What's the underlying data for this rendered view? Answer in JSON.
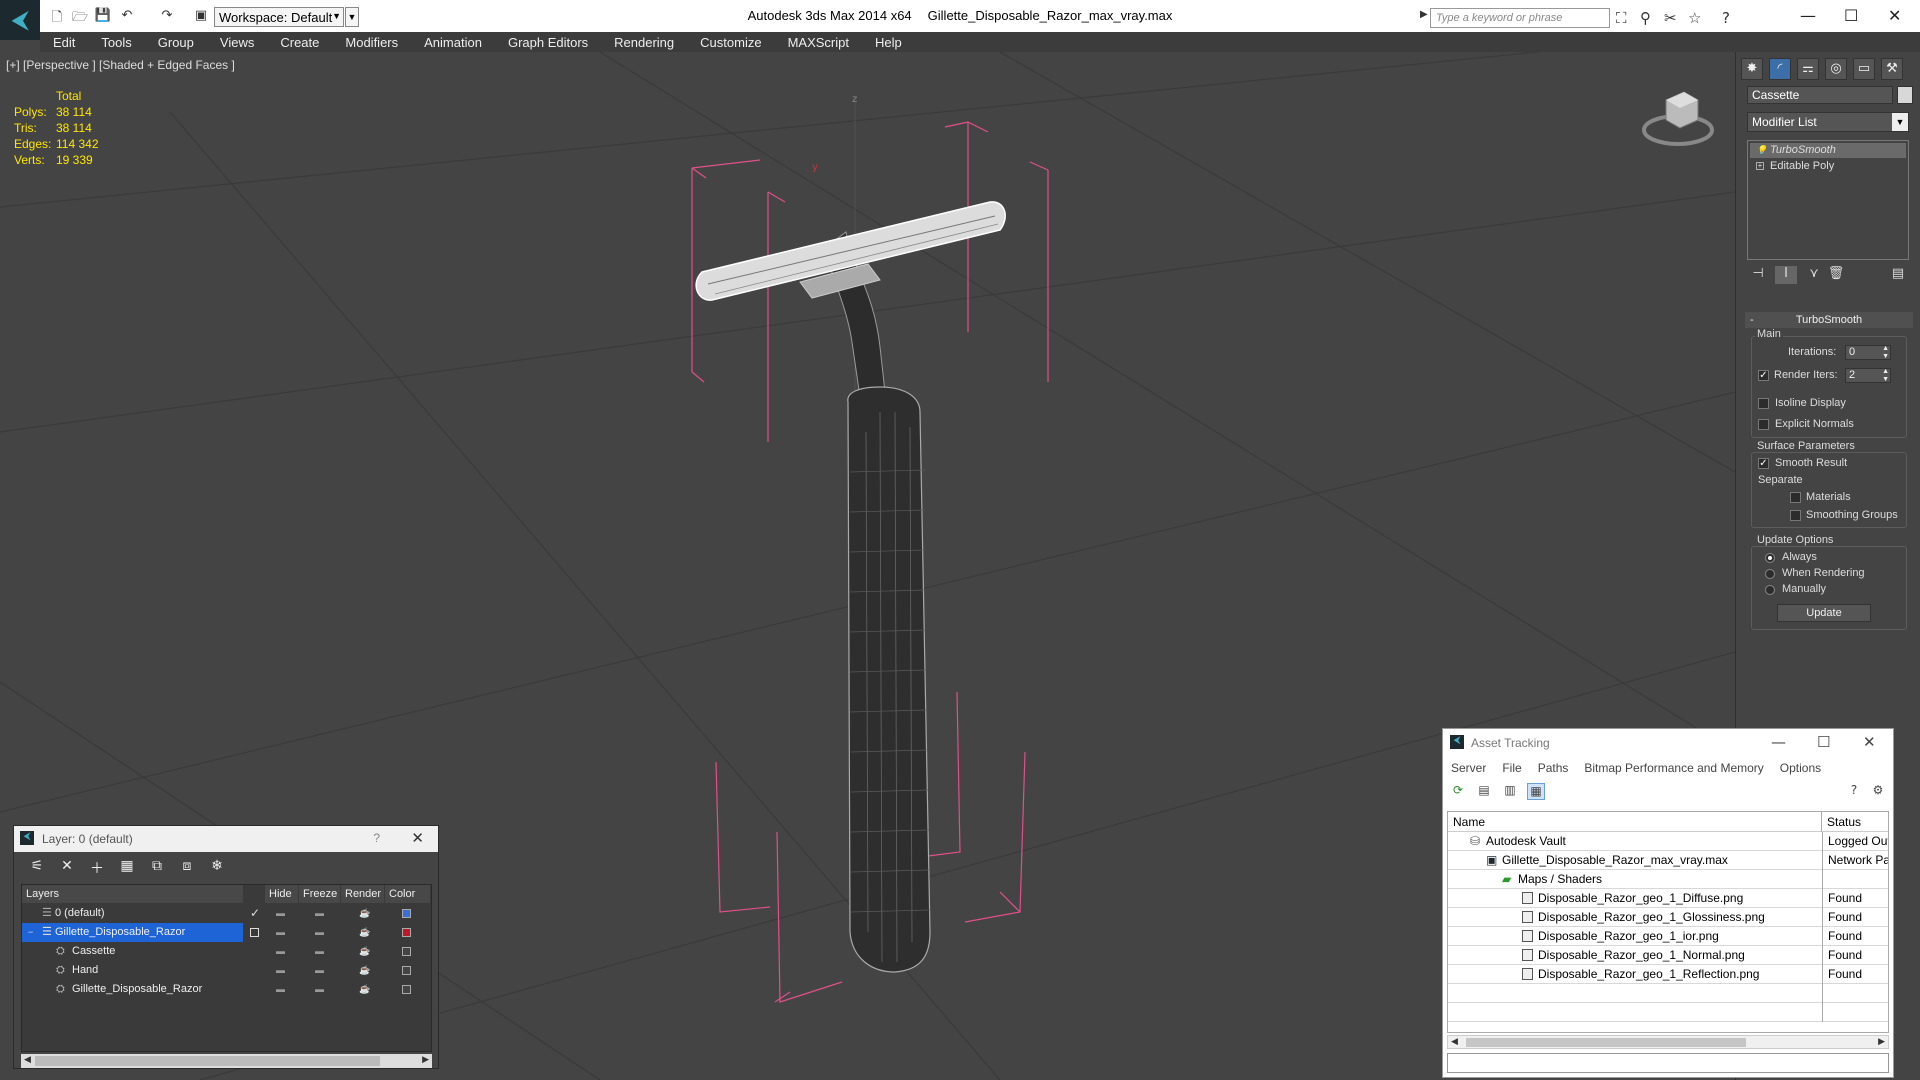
{
  "titlebar": {
    "workspace": "Workspace: Default",
    "app_name": "Autodesk 3ds Max  2014 x64",
    "file_name": "Gillette_Disposable_Razor_max_vray.max",
    "search_placeholder": "Type a keyword or phrase"
  },
  "menu": [
    "Edit",
    "Tools",
    "Group",
    "Views",
    "Create",
    "Modifiers",
    "Animation",
    "Graph Editors",
    "Rendering",
    "Customize",
    "MAXScript",
    "Help"
  ],
  "viewport": {
    "label": "[+] [Perspective ] [Shaded + Edged Faces ]",
    "stats": {
      "header": "Total",
      "polys_label": "Polys:",
      "polys": "38 114",
      "tris_label": "Tris:",
      "tris": "38 114",
      "edges_label": "Edges:",
      "edges": "114 342",
      "verts_label": "Verts:",
      "verts": "19 339"
    },
    "axis_z": "z",
    "axis_y": "y"
  },
  "command_panel": {
    "object_name": "Cassette",
    "modifier_list": "Modifier List",
    "stack": [
      "TurboSmooth",
      "Editable Poly"
    ],
    "turbosmooth": {
      "title": "TurboSmooth",
      "main": "Main",
      "iterations_label": "Iterations:",
      "iterations": "0",
      "render_iters_label": "Render Iters:",
      "render_iters": "2",
      "isoline": "Isoline Display",
      "explicit": "Explicit Normals",
      "surface": "Surface Parameters",
      "smooth": "Smooth Result",
      "separate": "Separate",
      "materials": "Materials",
      "smoothing": "Smoothing Groups",
      "update_options": "Update Options",
      "always": "Always",
      "when_rendering": "When Rendering",
      "manually": "Manually",
      "update_btn": "Update"
    }
  },
  "layer_dialog": {
    "title": "Layer: 0 (default)",
    "help": "?",
    "columns": [
      "Layers",
      "Hide",
      "Freeze",
      "Render",
      "Color"
    ],
    "rows": [
      {
        "name": "0 (default)",
        "color": "#3b6fd8"
      },
      {
        "name": "Gillette_Disposable_Razor",
        "color": "#c0182a"
      },
      {
        "name": "Cassette",
        "color": "#444444"
      },
      {
        "name": "Hand",
        "color": "#444444"
      },
      {
        "name": "Gillette_Disposable_Razor",
        "color": "#444444"
      }
    ]
  },
  "asset_tracking": {
    "title": "Asset Tracking",
    "menu": [
      "Server",
      "File",
      "Paths",
      "Bitmap Performance and Memory",
      "Options"
    ],
    "columns": [
      "Name",
      "Status"
    ],
    "rows": [
      {
        "name": "Autodesk Vault",
        "status": "Logged Out"
      },
      {
        "name": "Gillette_Disposable_Razor_max_vray.max",
        "status": "Network Path"
      },
      {
        "name": "Maps / Shaders",
        "status": ""
      },
      {
        "name": "Disposable_Razor_geo_1_Diffuse.png",
        "status": "Found"
      },
      {
        "name": "Disposable_Razor_geo_1_Glossiness.png",
        "status": "Found"
      },
      {
        "name": "Disposable_Razor_geo_1_ior.png",
        "status": "Found"
      },
      {
        "name": "Disposable_Razor_geo_1_Normal.png",
        "status": "Found"
      },
      {
        "name": "Disposable_Razor_geo_1_Reflection.png",
        "status": "Found"
      }
    ]
  },
  "colors": {
    "selection": "#1e64d6",
    "stats": "#ffe600",
    "bbox": "#e0508a"
  }
}
